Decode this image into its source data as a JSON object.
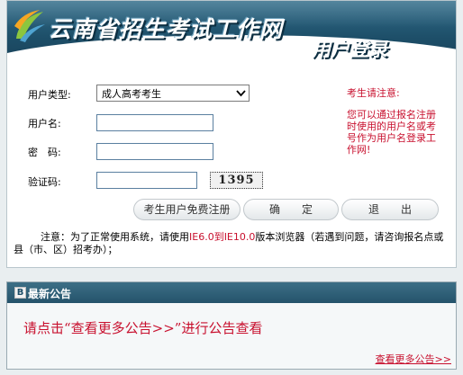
{
  "header": {
    "site_title": "云南省招生考试工作网",
    "page_title": "用户登录"
  },
  "form": {
    "user_type_label": "用户类型:",
    "user_type_selected": "成人高考考生",
    "username_label": "用户名:",
    "password_label": "密　码:",
    "captcha_label": "验证码:",
    "captcha_value": "1395",
    "username_value": "",
    "password_value": "",
    "captcha_input_value": ""
  },
  "buttons": {
    "register": "考生用户免费注册",
    "confirm": "确　　定",
    "exit": "退　　出"
  },
  "notice": {
    "title": "考生请注意:",
    "body": "您可以通过报名注册时使用的用户名或考号作为用户名登录工作网!"
  },
  "note": {
    "prefix": "注意：为了正常使用系统，请使用",
    "browsers": "IE6.0到IE10.0",
    "suffix": "版本浏览器（若遇到问题，请咨询报名点或县（市、区）招考办）；"
  },
  "announcement": {
    "title": "最新公告",
    "icon_letter": "B",
    "message": "请点击“查看更多公告>>”进行公告查看",
    "more_link": "查看更多公告>>"
  },
  "colors": {
    "banner": "#1d4e68",
    "accent_red": "#c8102e",
    "page_bg": "#e9eef0"
  },
  "icons": {
    "logo": "leaf-swoosh-logo-icon",
    "dropdown": "chevron-down-icon",
    "announcement": "announcement-icon"
  }
}
